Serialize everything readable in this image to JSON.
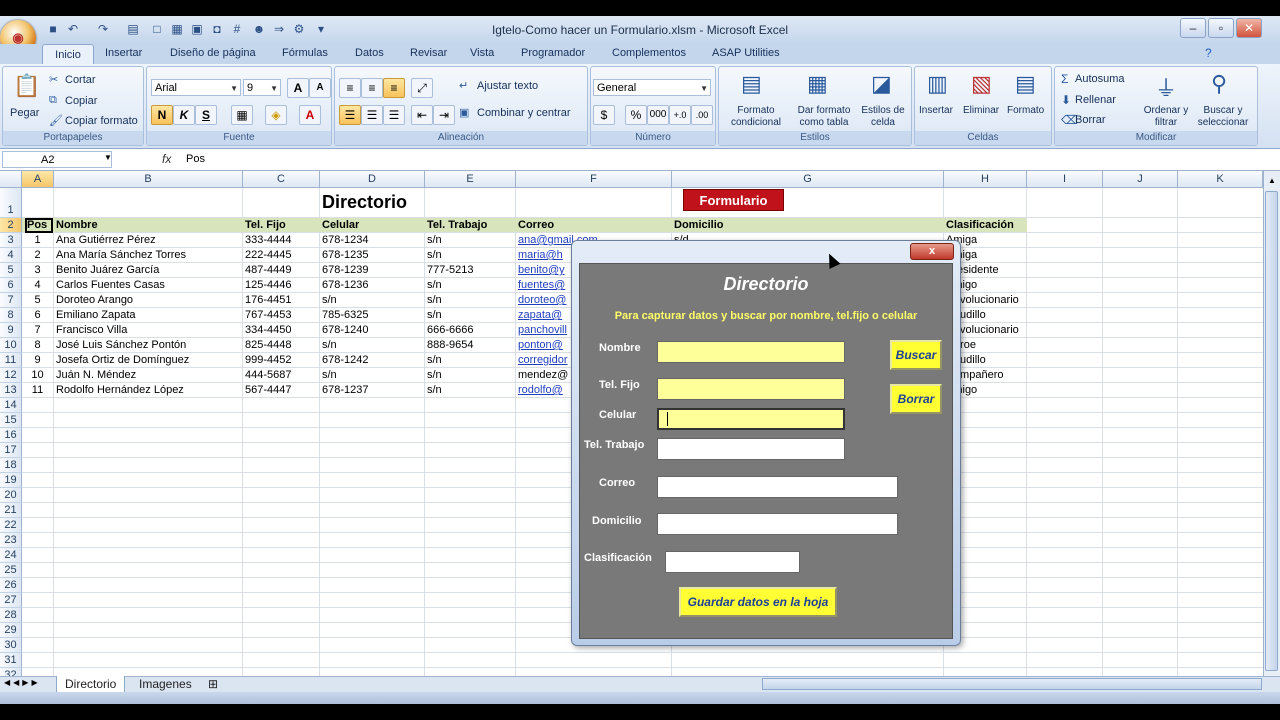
{
  "window": {
    "title": "Igtelo-Como hacer un Formulario.xlsm - Microsoft Excel",
    "minimize": "–",
    "maximize": "▫",
    "close": "✕"
  },
  "ribbon_tabs": [
    "Inicio",
    "Insertar",
    "Diseño de página",
    "Fórmulas",
    "Datos",
    "Revisar",
    "Vista",
    "Programador",
    "Complementos",
    "ASAP Utilities"
  ],
  "clipboard": {
    "paste": "Pegar",
    "cut": "Cortar",
    "copy": "Copiar",
    "format_painter": "Copiar formato",
    "group": "Portapapeles"
  },
  "font": {
    "name": "Arial",
    "size": "9",
    "bold": "N",
    "italic": "K",
    "underline": "S",
    "group": "Fuente"
  },
  "alignment": {
    "wrap": "Ajustar texto",
    "merge": "Combinar y centrar",
    "group": "Alineación"
  },
  "number": {
    "format": "General",
    "currency": "$",
    "percent": "%",
    "thousands": "000",
    "group": "Número"
  },
  "styles": {
    "conditional": "Formato condicional",
    "table": "Dar formato como tabla",
    "cell": "Estilos de celda",
    "group": "Estilos"
  },
  "cells": {
    "insert": "Insertar",
    "delete": "Eliminar",
    "format": "Formato",
    "group": "Celdas"
  },
  "editing": {
    "autosum": "Autosuma",
    "fill": "Rellenar",
    "clear": "Borrar",
    "sort": "Ordenar y filtrar",
    "find": "Buscar y seleccionar",
    "group": "Modificar"
  },
  "formula_bar": {
    "name_box": "A2",
    "fx": "fx",
    "content": "Pos"
  },
  "sheet": {
    "columns": [
      "A",
      "B",
      "C",
      "D",
      "E",
      "F",
      "G",
      "H",
      "I",
      "J",
      "K"
    ],
    "title": "Directorio",
    "form_button": "Formulario",
    "headers": [
      "Pos",
      "Nombre",
      "Tel. Fijo",
      "Celular",
      "Tel. Trabajo",
      "Correo",
      "Domicilio",
      "Clasificación"
    ],
    "rows": [
      [
        "1",
        "Ana Gutiérrez Pérez",
        "333-4444",
        "678-1234",
        "s/n",
        "ana@gmail.com",
        "s/d",
        "Amiga"
      ],
      [
        "2",
        "Ana María Sánchez Torres",
        "222-4445",
        "678-1235",
        "s/n",
        "maria@h",
        "",
        "Amiga"
      ],
      [
        "3",
        "Benito Juárez García",
        "487-4449",
        "678-1239",
        "777-5213",
        "benito@y",
        "",
        "Presidente"
      ],
      [
        "4",
        "Carlos Fuentes Casas",
        "125-4446",
        "678-1236",
        "s/n",
        "fuentes@",
        "",
        "Amigo"
      ],
      [
        "5",
        "Doroteo Arango",
        "176-4451",
        "s/n",
        "s/n",
        "doroteo@",
        "",
        "Revolucionario"
      ],
      [
        "6",
        "Emiliano Zapata",
        "767-4453",
        "785-6325",
        "s/n",
        "zapata@",
        "",
        "Caudillo"
      ],
      [
        "7",
        "Francisco Villa",
        "334-4450",
        "678-1240",
        "666-6666",
        "panchovill",
        "",
        "Revolucionario"
      ],
      [
        "8",
        "José Luis Sánchez Pontón",
        "825-4448",
        "s/n",
        "888-9654",
        "ponton@",
        "",
        "Héroe"
      ],
      [
        "9",
        "Josefa Ortiz de Domínguez",
        "999-4452",
        "678-1242",
        "s/n",
        "corregidor",
        "",
        "Caudillo"
      ],
      [
        "10",
        "Juán N. Méndez",
        "444-5687",
        "s/n",
        "s/n",
        "mendez@",
        "",
        "Compañero"
      ],
      [
        "11",
        "Rodolfo Hernández López",
        "567-4447",
        "678-1237",
        "s/n",
        "rodolfo@",
        "",
        "Amigo"
      ]
    ],
    "row_numbers": [
      "1",
      "2",
      "3",
      "4",
      "5",
      "6",
      "7",
      "8",
      "9",
      "10",
      "11",
      "12",
      "13",
      "14",
      "15",
      "16",
      "17",
      "18",
      "19",
      "20",
      "21",
      "22",
      "23",
      "24",
      "25",
      "26",
      "27",
      "28",
      "29",
      "30",
      "31",
      "32"
    ]
  },
  "sheet_tabs": [
    "Directorio",
    "Imagenes"
  ],
  "dialog": {
    "close": "x",
    "title": "Directorio",
    "subtitle": "Para capturar datos y buscar por nombre, tel.fijo o celular",
    "labels": {
      "nombre": "Nombre",
      "tel_fijo": "Tel. Fijo",
      "celular": "Celular",
      "tel_trabajo": "Tel. Trabajo",
      "correo": "Correo",
      "domicilio": "Domicilio",
      "clasificacion": "Clasificación"
    },
    "buttons": {
      "search": "Buscar",
      "clear": "Borrar",
      "save": "Guardar datos en la hoja"
    }
  },
  "colors": {
    "form_button": "#c0121b",
    "header_band": "#d8e4bc",
    "dialog_body": "#797979",
    "dialog_button": "#ffff33",
    "input_highlight": "#ffff99"
  }
}
